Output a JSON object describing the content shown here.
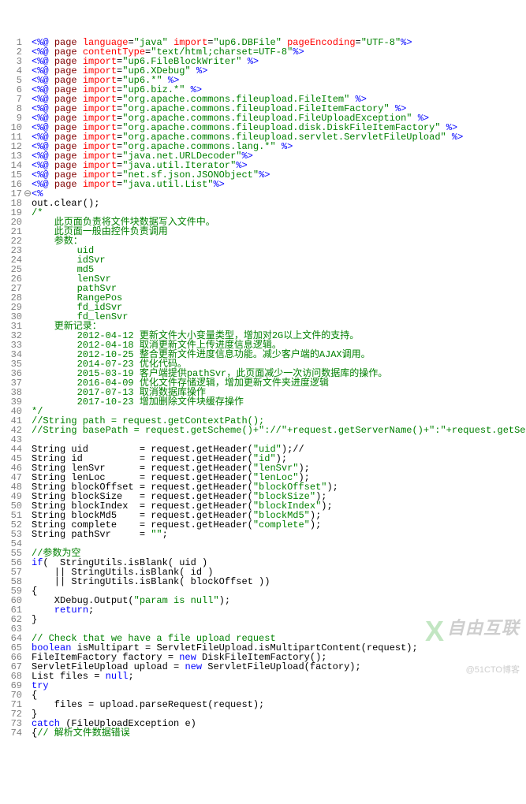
{
  "watermark": {
    "big": "自由互联",
    "small": "@51CTO博客"
  },
  "lines": [
    {
      "n": 1,
      "spans": [
        [
          "tag",
          "<%@"
        ],
        [
          "txt",
          " "
        ],
        [
          "kw-page",
          "page"
        ],
        [
          "txt",
          " "
        ],
        [
          "attr",
          "language"
        ],
        [
          "txt",
          "="
        ],
        [
          "str",
          "\"java\""
        ],
        [
          "txt",
          " "
        ],
        [
          "attr",
          "import"
        ],
        [
          "txt",
          "="
        ],
        [
          "str",
          "\"up6.DBFile\""
        ],
        [
          "txt",
          " "
        ],
        [
          "attr",
          "pageEncoding"
        ],
        [
          "txt",
          "="
        ],
        [
          "str",
          "\"UTF-8\""
        ],
        [
          "tag",
          "%>"
        ]
      ]
    },
    {
      "n": 2,
      "spans": [
        [
          "tag",
          "<%@"
        ],
        [
          "txt",
          " "
        ],
        [
          "kw-page",
          "page"
        ],
        [
          "txt",
          " "
        ],
        [
          "attr",
          "contentType"
        ],
        [
          "txt",
          "="
        ],
        [
          "str",
          "\"text/html;charset=UTF-8\""
        ],
        [
          "tag",
          "%>"
        ]
      ]
    },
    {
      "n": 3,
      "spans": [
        [
          "tag",
          "<%@"
        ],
        [
          "txt",
          " "
        ],
        [
          "kw-page",
          "page"
        ],
        [
          "txt",
          " "
        ],
        [
          "attr",
          "import"
        ],
        [
          "txt",
          "="
        ],
        [
          "str",
          "\"up6.FileBlockWriter\""
        ],
        [
          "txt",
          " "
        ],
        [
          "tag",
          "%>"
        ]
      ]
    },
    {
      "n": 4,
      "spans": [
        [
          "tag",
          "<%@"
        ],
        [
          "txt",
          " "
        ],
        [
          "kw-page",
          "page"
        ],
        [
          "txt",
          " "
        ],
        [
          "attr",
          "import"
        ],
        [
          "txt",
          "="
        ],
        [
          "str",
          "\"up6.XDebug\""
        ],
        [
          "txt",
          " "
        ],
        [
          "tag",
          "%>"
        ]
      ]
    },
    {
      "n": 5,
      "spans": [
        [
          "tag",
          "<%@"
        ],
        [
          "txt",
          " "
        ],
        [
          "kw-page",
          "page"
        ],
        [
          "txt",
          " "
        ],
        [
          "attr",
          "import"
        ],
        [
          "txt",
          "="
        ],
        [
          "str",
          "\"up6.*\""
        ],
        [
          "txt",
          " "
        ],
        [
          "tag",
          "%>"
        ]
      ]
    },
    {
      "n": 6,
      "spans": [
        [
          "tag",
          "<%@"
        ],
        [
          "txt",
          " "
        ],
        [
          "kw-page",
          "page"
        ],
        [
          "txt",
          " "
        ],
        [
          "attr",
          "import"
        ],
        [
          "txt",
          "="
        ],
        [
          "str",
          "\"up6.biz.*\""
        ],
        [
          "txt",
          " "
        ],
        [
          "tag",
          "%>"
        ]
      ]
    },
    {
      "n": 7,
      "spans": [
        [
          "tag",
          "<%@"
        ],
        [
          "txt",
          " "
        ],
        [
          "kw-page",
          "page"
        ],
        [
          "txt",
          " "
        ],
        [
          "attr",
          "import"
        ],
        [
          "txt",
          "="
        ],
        [
          "str",
          "\"org.apache.commons.fileupload.FileItem\""
        ],
        [
          "txt",
          " "
        ],
        [
          "tag",
          "%>"
        ]
      ]
    },
    {
      "n": 8,
      "spans": [
        [
          "tag",
          "<%@"
        ],
        [
          "txt",
          " "
        ],
        [
          "kw-page",
          "page"
        ],
        [
          "txt",
          " "
        ],
        [
          "attr",
          "import"
        ],
        [
          "txt",
          "="
        ],
        [
          "str",
          "\"org.apache.commons.fileupload.FileItemFactory\""
        ],
        [
          "txt",
          " "
        ],
        [
          "tag",
          "%>"
        ]
      ]
    },
    {
      "n": 9,
      "spans": [
        [
          "tag",
          "<%@"
        ],
        [
          "txt",
          " "
        ],
        [
          "kw-page",
          "page"
        ],
        [
          "txt",
          " "
        ],
        [
          "attr",
          "import"
        ],
        [
          "txt",
          "="
        ],
        [
          "str",
          "\"org.apache.commons.fileupload.FileUploadException\""
        ],
        [
          "txt",
          " "
        ],
        [
          "tag",
          "%>"
        ]
      ]
    },
    {
      "n": 10,
      "spans": [
        [
          "tag",
          "<%@"
        ],
        [
          "txt",
          " "
        ],
        [
          "kw-page",
          "page"
        ],
        [
          "txt",
          " "
        ],
        [
          "attr",
          "import"
        ],
        [
          "txt",
          "="
        ],
        [
          "str",
          "\"org.apache.commons.fileupload.disk.DiskFileItemFactory\""
        ],
        [
          "txt",
          " "
        ],
        [
          "tag",
          "%>"
        ]
      ]
    },
    {
      "n": 11,
      "spans": [
        [
          "tag",
          "<%@"
        ],
        [
          "txt",
          " "
        ],
        [
          "kw-page",
          "page"
        ],
        [
          "txt",
          " "
        ],
        [
          "attr",
          "import"
        ],
        [
          "txt",
          "="
        ],
        [
          "str",
          "\"org.apache.commons.fileupload.servlet.ServletFileUpload\""
        ],
        [
          "txt",
          " "
        ],
        [
          "tag",
          "%>"
        ]
      ]
    },
    {
      "n": 12,
      "spans": [
        [
          "tag",
          "<%@"
        ],
        [
          "txt",
          " "
        ],
        [
          "kw-page",
          "page"
        ],
        [
          "txt",
          " "
        ],
        [
          "attr",
          "import"
        ],
        [
          "txt",
          "="
        ],
        [
          "str",
          "\"org.apache.commons.lang.*\""
        ],
        [
          "txt",
          " "
        ],
        [
          "tag",
          "%>"
        ]
      ]
    },
    {
      "n": 13,
      "spans": [
        [
          "tag",
          "<%@"
        ],
        [
          "txt",
          " "
        ],
        [
          "kw-page",
          "page"
        ],
        [
          "txt",
          " "
        ],
        [
          "attr",
          "import"
        ],
        [
          "txt",
          "="
        ],
        [
          "str",
          "\"java.net.URLDecoder\""
        ],
        [
          "tag",
          "%>"
        ]
      ]
    },
    {
      "n": 14,
      "spans": [
        [
          "tag",
          "<%@"
        ],
        [
          "txt",
          " "
        ],
        [
          "kw-page",
          "page"
        ],
        [
          "txt",
          " "
        ],
        [
          "attr",
          "import"
        ],
        [
          "txt",
          "="
        ],
        [
          "str",
          "\"java.util.Iterator\""
        ],
        [
          "tag",
          "%>"
        ]
      ]
    },
    {
      "n": 15,
      "spans": [
        [
          "tag",
          "<%@"
        ],
        [
          "txt",
          " "
        ],
        [
          "kw-page",
          "page"
        ],
        [
          "txt",
          " "
        ],
        [
          "attr",
          "import"
        ],
        [
          "txt",
          "="
        ],
        [
          "str",
          "\"net.sf.json.JSONObject\""
        ],
        [
          "tag",
          "%>"
        ]
      ]
    },
    {
      "n": 16,
      "spans": [
        [
          "tag",
          "<%@"
        ],
        [
          "txt",
          " "
        ],
        [
          "kw-page",
          "page"
        ],
        [
          "txt",
          " "
        ],
        [
          "attr",
          "import"
        ],
        [
          "txt",
          "="
        ],
        [
          "str",
          "\"java.util.List\""
        ],
        [
          "tag",
          "%>"
        ]
      ]
    },
    {
      "n": 17,
      "fold": "⊖",
      "spans": [
        [
          "tag",
          "<%"
        ]
      ]
    },
    {
      "n": 18,
      "spans": [
        [
          "txt",
          "out.clear();"
        ]
      ]
    },
    {
      "n": 19,
      "spans": [
        [
          "cmt",
          "/*"
        ]
      ]
    },
    {
      "n": 20,
      "spans": [
        [
          "cmt",
          "    此页面负责将文件块数据写入文件中。"
        ]
      ]
    },
    {
      "n": 21,
      "spans": [
        [
          "cmt",
          "    此页面一般由控件负责调用"
        ]
      ]
    },
    {
      "n": 22,
      "spans": [
        [
          "cmt",
          "    参数："
        ]
      ]
    },
    {
      "n": 23,
      "spans": [
        [
          "cmt",
          "        uid"
        ]
      ]
    },
    {
      "n": 24,
      "spans": [
        [
          "cmt",
          "        idSvr"
        ]
      ]
    },
    {
      "n": 25,
      "spans": [
        [
          "cmt",
          "        md5"
        ]
      ]
    },
    {
      "n": 26,
      "spans": [
        [
          "cmt",
          "        lenSvr"
        ]
      ]
    },
    {
      "n": 27,
      "spans": [
        [
          "cmt",
          "        pathSvr"
        ]
      ]
    },
    {
      "n": 28,
      "spans": [
        [
          "cmt",
          "        RangePos"
        ]
      ]
    },
    {
      "n": 29,
      "spans": [
        [
          "cmt",
          "        fd_idSvr"
        ]
      ]
    },
    {
      "n": 30,
      "spans": [
        [
          "cmt",
          "        fd_lenSvr"
        ]
      ]
    },
    {
      "n": 31,
      "spans": [
        [
          "cmt",
          "    更新记录："
        ]
      ]
    },
    {
      "n": 32,
      "spans": [
        [
          "cmt",
          "        2012-04-12 更新文件大小变量类型，增加对2G以上文件的支持。"
        ]
      ]
    },
    {
      "n": 33,
      "spans": [
        [
          "cmt",
          "        2012-04-18 取消更新文件上传进度信息逻辑。"
        ]
      ]
    },
    {
      "n": 34,
      "spans": [
        [
          "cmt",
          "        2012-10-25 整合更新文件进度信息功能。减少客户端的AJAX调用。"
        ]
      ]
    },
    {
      "n": 35,
      "spans": [
        [
          "cmt",
          "        2014-07-23 优化代码。"
        ]
      ]
    },
    {
      "n": 36,
      "spans": [
        [
          "cmt",
          "        2015-03-19 客户端提供pathSvr，此页面减少一次访问数据库的操作。"
        ]
      ]
    },
    {
      "n": 37,
      "spans": [
        [
          "cmt",
          "        2016-04-09 优化文件存储逻辑，增加更新文件夹进度逻辑"
        ]
      ]
    },
    {
      "n": 38,
      "spans": [
        [
          "cmt",
          "        2017-07-13 取消数据库操作"
        ]
      ]
    },
    {
      "n": 39,
      "spans": [
        [
          "cmt",
          "        2017-10-23 增加删除文件块缓存操作"
        ]
      ]
    },
    {
      "n": 40,
      "spans": [
        [
          "cmt",
          "*/"
        ]
      ]
    },
    {
      "n": 41,
      "spans": [
        [
          "cmt",
          "//String path = request.getContextPath();"
        ]
      ]
    },
    {
      "n": 42,
      "spans": [
        [
          "cmt",
          "//String basePath = request.getScheme()+\"://\"+request.getServerName()+\":\"+request.getServerPort()+path+\"/\";"
        ]
      ]
    },
    {
      "n": 43,
      "spans": [
        [
          "txt",
          ""
        ]
      ]
    },
    {
      "n": 44,
      "spans": [
        [
          "txt",
          "String uid         = request.getHeader("
        ],
        [
          "str",
          "\"uid\""
        ],
        [
          "txt",
          ");//"
        ]
      ]
    },
    {
      "n": 45,
      "spans": [
        [
          "txt",
          "String id          = request.getHeader("
        ],
        [
          "str",
          "\"id\""
        ],
        [
          "txt",
          ");"
        ]
      ]
    },
    {
      "n": 46,
      "spans": [
        [
          "txt",
          "String lenSvr      = request.getHeader("
        ],
        [
          "str",
          "\"lenSvr\""
        ],
        [
          "txt",
          ");"
        ]
      ]
    },
    {
      "n": 47,
      "spans": [
        [
          "txt",
          "String lenLoc      = request.getHeader("
        ],
        [
          "str",
          "\"lenLoc\""
        ],
        [
          "txt",
          ");"
        ]
      ]
    },
    {
      "n": 48,
      "spans": [
        [
          "txt",
          "String blockOffset = request.getHeader("
        ],
        [
          "str",
          "\"blockOffset\""
        ],
        [
          "txt",
          ");"
        ]
      ]
    },
    {
      "n": 49,
      "spans": [
        [
          "txt",
          "String blockSize   = request.getHeader("
        ],
        [
          "str",
          "\"blockSize\""
        ],
        [
          "txt",
          ");"
        ]
      ]
    },
    {
      "n": 50,
      "spans": [
        [
          "txt",
          "String blockIndex  = request.getHeader("
        ],
        [
          "str",
          "\"blockIndex\""
        ],
        [
          "txt",
          ");"
        ]
      ]
    },
    {
      "n": 51,
      "spans": [
        [
          "txt",
          "String blockMd5    = request.getHeader("
        ],
        [
          "str",
          "\"blockMd5\""
        ],
        [
          "txt",
          ");"
        ]
      ]
    },
    {
      "n": 52,
      "spans": [
        [
          "txt",
          "String complete    = request.getHeader("
        ],
        [
          "str",
          "\"complete\""
        ],
        [
          "txt",
          ");"
        ]
      ]
    },
    {
      "n": 53,
      "spans": [
        [
          "txt",
          "String pathSvr     = "
        ],
        [
          "str",
          "\"\""
        ],
        [
          "txt",
          ";"
        ]
      ]
    },
    {
      "n": 54,
      "spans": [
        [
          "txt",
          ""
        ]
      ]
    },
    {
      "n": 55,
      "spans": [
        [
          "cmt",
          "//参数为空"
        ]
      ]
    },
    {
      "n": 56,
      "spans": [
        [
          "kw",
          "if"
        ],
        [
          "txt",
          "(  StringUtils.isBlank( uid )"
        ]
      ]
    },
    {
      "n": 57,
      "spans": [
        [
          "txt",
          "    || StringUtils.isBlank( id )"
        ]
      ]
    },
    {
      "n": 58,
      "spans": [
        [
          "txt",
          "    || StringUtils.isBlank( blockOffset ))"
        ]
      ]
    },
    {
      "n": 59,
      "spans": [
        [
          "txt",
          "{"
        ]
      ]
    },
    {
      "n": 60,
      "spans": [
        [
          "txt",
          "    XDebug.Output("
        ],
        [
          "str",
          "\"param is null\""
        ],
        [
          "txt",
          ");"
        ]
      ]
    },
    {
      "n": 61,
      "spans": [
        [
          "txt",
          "    "
        ],
        [
          "kw",
          "return"
        ],
        [
          "txt",
          ";"
        ]
      ]
    },
    {
      "n": 62,
      "spans": [
        [
          "txt",
          "}"
        ]
      ]
    },
    {
      "n": 63,
      "spans": [
        [
          "txt",
          ""
        ]
      ]
    },
    {
      "n": 64,
      "spans": [
        [
          "cmt",
          "// Check that we have a file upload request"
        ]
      ]
    },
    {
      "n": 65,
      "spans": [
        [
          "kw",
          "boolean"
        ],
        [
          "txt",
          " isMultipart = ServletFileUpload.isMultipartContent(request);"
        ]
      ]
    },
    {
      "n": 66,
      "spans": [
        [
          "txt",
          "FileItemFactory factory = "
        ],
        [
          "kw",
          "new"
        ],
        [
          "txt",
          " DiskFileItemFactory();  "
        ]
      ]
    },
    {
      "n": 67,
      "spans": [
        [
          "txt",
          "ServletFileUpload upload = "
        ],
        [
          "kw",
          "new"
        ],
        [
          "txt",
          " ServletFileUpload(factory);"
        ]
      ]
    },
    {
      "n": 68,
      "spans": [
        [
          "txt",
          "List files = "
        ],
        [
          "kw",
          "null"
        ],
        [
          "txt",
          ";"
        ]
      ]
    },
    {
      "n": 69,
      "spans": [
        [
          "kw",
          "try"
        ]
      ]
    },
    {
      "n": 70,
      "spans": [
        [
          "txt",
          "{"
        ]
      ]
    },
    {
      "n": 71,
      "spans": [
        [
          "txt",
          "    files = upload.parseRequest(request);"
        ]
      ]
    },
    {
      "n": 72,
      "spans": [
        [
          "txt",
          "}"
        ]
      ]
    },
    {
      "n": 73,
      "spans": [
        [
          "kw",
          "catch"
        ],
        [
          "txt",
          " (FileUploadException e)"
        ]
      ]
    },
    {
      "n": 74,
      "spans": [
        [
          "txt",
          "{"
        ],
        [
          "cmt",
          "// 解析文件数据错误  "
        ]
      ]
    }
  ]
}
